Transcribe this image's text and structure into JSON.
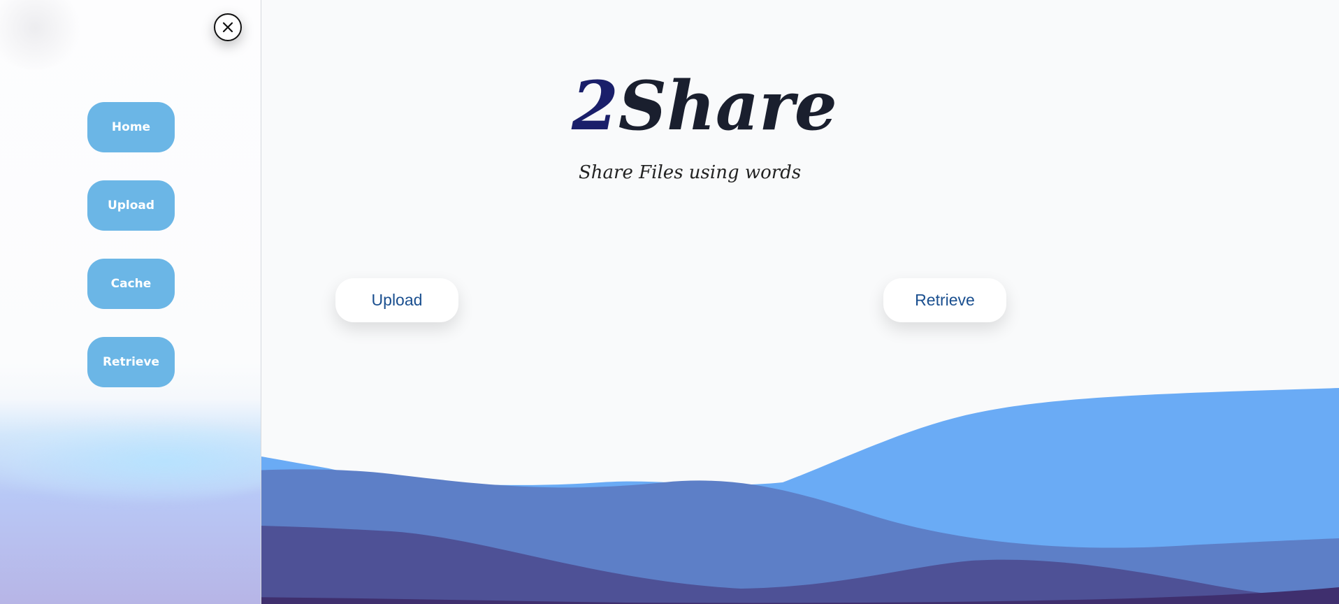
{
  "brand": {
    "prefix": "2",
    "name": "Share"
  },
  "tagline": "Share Files using words",
  "sidebar": {
    "close_icon": "close-x-icon",
    "items": [
      {
        "label": "Home"
      },
      {
        "label": "Upload"
      },
      {
        "label": "Cache"
      },
      {
        "label": "Retrieve"
      }
    ]
  },
  "actions": {
    "upload_label": "Upload",
    "retrieve_label": "Retrieve"
  },
  "colors": {
    "nav_button": "#6bb6e6",
    "brand_text": "#1a1f2e",
    "brand_digit": "#1a1f6a",
    "action_text": "#1a4f8f",
    "wave_light": "#6aabf5",
    "wave_mid": "#5d7fc7",
    "wave_dark": "#4e5196",
    "wave_deepest": "#3f2f6e"
  }
}
